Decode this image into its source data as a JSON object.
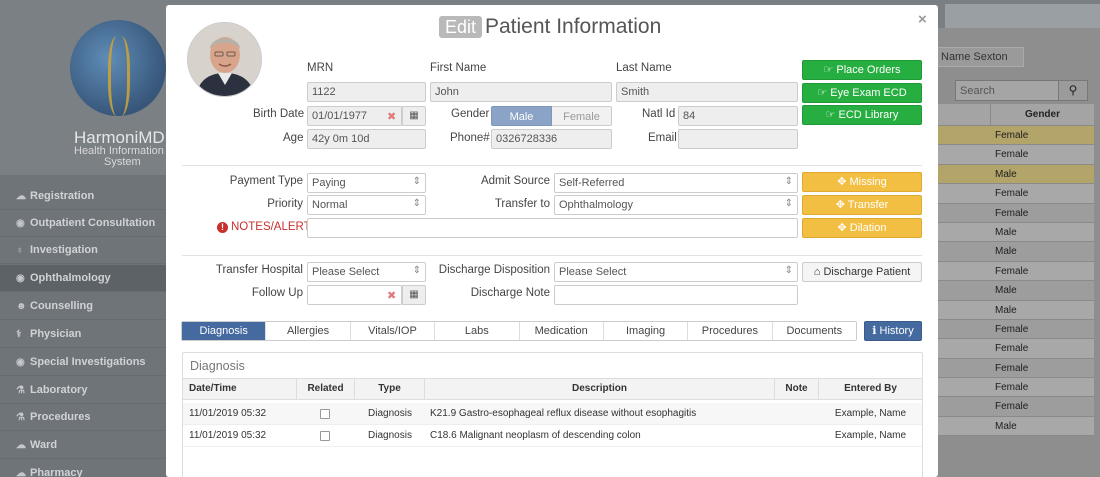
{
  "app": {
    "brand_name": "HarmoniMD",
    "brand_sub_line1": "Health Information",
    "brand_sub_line2": "System"
  },
  "sidebar": {
    "items": [
      {
        "label": "Registration",
        "icon": "cloud-icon"
      },
      {
        "label": "Outpatient Consultation",
        "icon": "eye-icon"
      },
      {
        "label": "Investigation",
        "icon": "lightbulb-icon"
      },
      {
        "label": "Ophthalmology",
        "icon": "eye-icon"
      },
      {
        "label": "Counselling",
        "icon": "users-icon"
      },
      {
        "label": "Physician",
        "icon": "stethoscope-icon"
      },
      {
        "label": "Special Investigations",
        "icon": "eye-icon"
      },
      {
        "label": "Laboratory",
        "icon": "flask-icon"
      },
      {
        "label": "Procedures",
        "icon": "flask-icon"
      },
      {
        "label": "Ward",
        "icon": "cloud-icon"
      },
      {
        "label": "Pharmacy",
        "icon": "cloud-icon"
      }
    ]
  },
  "background": {
    "name_box": "Name Sexton",
    "search_placeholder": "Search",
    "gender_header": "Gender",
    "gender_rows": [
      "Female",
      "Female",
      "Male",
      "Female",
      "Female",
      "Male",
      "Male",
      "Female",
      "Male",
      "Male",
      "Female",
      "Female",
      "Female",
      "Female",
      "Female",
      "Male"
    ]
  },
  "modal": {
    "edit_badge": "Edit",
    "title": "Patient Information",
    "close": "×"
  },
  "patient": {
    "mrn_label": "MRN",
    "mrn": "1122",
    "first_name_label": "First Name",
    "first_name": "John",
    "last_name_label": "Last Name",
    "last_name": "Smith",
    "birth_date_label": "Birth Date",
    "birth_date": "01/01/1977",
    "gender_label": "Gender",
    "gender_male": "Male",
    "gender_female": "Female",
    "natl_id_label": "Natl Id",
    "natl_id": "84",
    "age_label": "Age",
    "age": "42y 0m 10d",
    "phone_label": "Phone#",
    "phone": "0326728336",
    "email_label": "Email",
    "email": ""
  },
  "actions": {
    "place_orders": "Place Orders",
    "eye_exam_ecd": "Eye Exam ECD",
    "ecd_library": "ECD Library",
    "missing": "Missing",
    "transfer": "Transfer",
    "dilation": "Dilation",
    "discharge_patient": "Discharge Patient",
    "history": "History"
  },
  "visit": {
    "payment_type_label": "Payment Type",
    "payment_type": "Paying",
    "priority_label": "Priority",
    "priority": "Normal",
    "notes_alerts_label": "NOTES/ALERTS",
    "admit_source_label": "Admit Source",
    "admit_source": "Self-Referred",
    "transfer_to_label": "Transfer to",
    "transfer_to": "Ophthalmology"
  },
  "discharge": {
    "transfer_hospital_label": "Transfer Hospital",
    "transfer_hospital": "Please Select",
    "follow_up_label": "Follow Up",
    "discharge_disposition_label": "Discharge Disposition",
    "discharge_disposition": "Please Select",
    "discharge_note_label": "Discharge Note"
  },
  "tabs": [
    "Diagnosis",
    "Allergies",
    "Vitals/IOP",
    "Labs",
    "Medication",
    "Imaging",
    "Procedures",
    "Documents"
  ],
  "diagnosis": {
    "title": "Diagnosis",
    "columns": [
      "Date/Time",
      "Related",
      "Type",
      "Description",
      "Note",
      "Entered By"
    ],
    "rows": [
      {
        "datetime": "11/01/2019 05:32",
        "type": "Diagnosis",
        "description": "K21.9 Gastro-esophageal reflux disease without esophagitis",
        "note": "",
        "entered_by": "Example, Name"
      },
      {
        "datetime": "11/01/2019 05:32",
        "type": "Diagnosis",
        "description": "C18.6 Malignant neoplasm of descending colon",
        "note": "",
        "entered_by": "Example, Name"
      }
    ]
  },
  "colors": {
    "green": "#27ae40",
    "yellow": "#f3bf43",
    "blue": "#456aa0",
    "alert_red": "#c9302c"
  }
}
